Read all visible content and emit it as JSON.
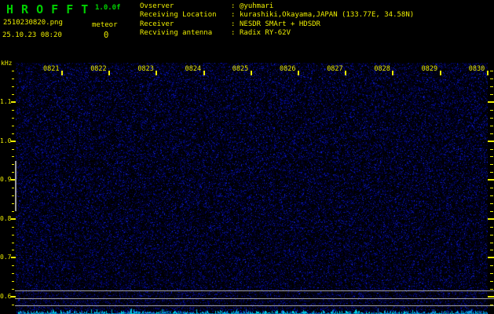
{
  "app": {
    "title": "H R O F F T",
    "version": "1.0.0f",
    "filename": "2510230820.png",
    "datetime": "25.10.23 08:20",
    "meteor_label": "meteor",
    "meteor_count": "0"
  },
  "info": {
    "separator": ":",
    "rows": [
      {
        "label": "Ovserver",
        "value": "@yuhmari"
      },
      {
        "label": "Receiving Location",
        "value": "kurashiki,Okayama,JAPAN (133.77E, 34.58N)"
      },
      {
        "label": "Receiver",
        "value": "NESDR SMArt + HDSDR"
      },
      {
        "label": "Recviving antenna",
        "value": "Radix RY-62V"
      }
    ]
  },
  "axes": {
    "y_unit": "kHz",
    "freq_labels": [
      "1.1",
      "1.0",
      "0.9",
      "0.8",
      "0.7",
      "0.6"
    ],
    "time_labels": [
      "0821",
      "0822",
      "0823",
      "0824",
      "0825",
      "0826",
      "0827",
      "0828",
      "0829",
      "0830"
    ]
  },
  "chart_data": {
    "type": "heatmap",
    "description": "Radio meteor-echo spectrogram, 10-minute window, background noise only, no meteor echoes visible",
    "ylabel": "kHz",
    "ytick_labels": [
      "1.1",
      "1.0",
      "0.9",
      "0.8",
      "0.7",
      "0.6"
    ],
    "ylim": [
      0.6,
      1.1
    ],
    "xtick_labels": [
      "0821",
      "0822",
      "0823",
      "0824",
      "0825",
      "0826",
      "0827",
      "0828",
      "0829",
      "0830"
    ],
    "meteor_count": 0
  },
  "colors": {
    "background": "#000000",
    "title_green": "#00CF00",
    "text_yellow": "#EDED00",
    "marker_grey": "#A0A0A0",
    "noise_blue": "#1818B0",
    "level_cyan": "#00C8DC"
  }
}
